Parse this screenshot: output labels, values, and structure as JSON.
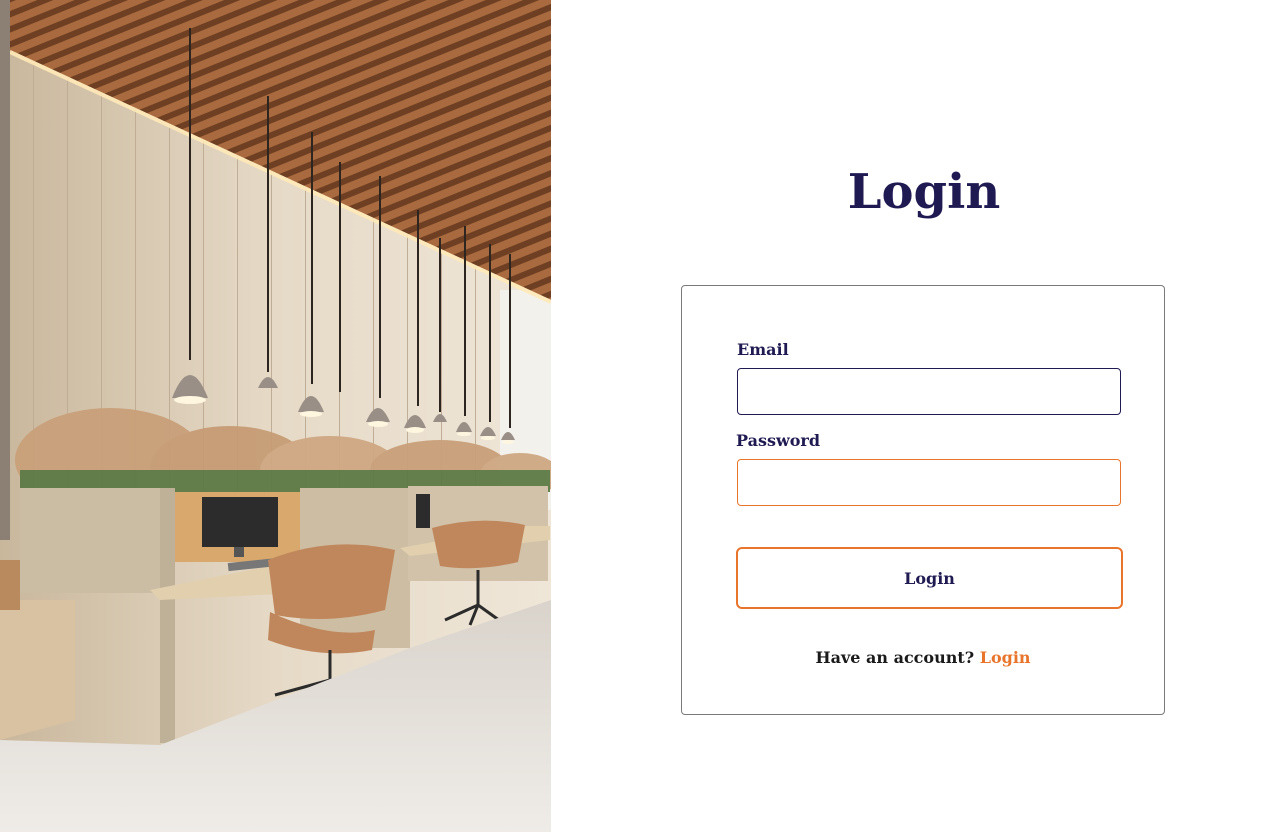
{
  "hero": {
    "image_name": "office-interior-illustration"
  },
  "title": "Login",
  "form": {
    "email_label": "Email",
    "email_value": "",
    "email_placeholder": "",
    "password_label": "Password",
    "password_value": "",
    "password_placeholder": "",
    "submit_label": "Login"
  },
  "footer": {
    "prompt": "Have an account?",
    "link_label": "Login"
  },
  "colors": {
    "primary": "#1f1a52",
    "accent": "#e8752b",
    "card_border": "#7a7a7a"
  }
}
